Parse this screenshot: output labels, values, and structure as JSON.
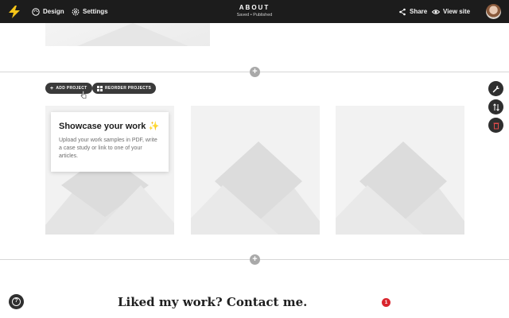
{
  "topbar": {
    "design_label": "Design",
    "settings_label": "Settings",
    "page_title": "ABOUT",
    "page_status": "Saved • Published",
    "share_label": "Share",
    "view_site_label": "View site"
  },
  "projects": {
    "add_label": "ADD PROJECT",
    "reorder_label": "REORDER PROJECTS",
    "tooltip_title": "Showcase your work",
    "tooltip_spark": "✨",
    "tooltip_body": "Upload your work samples in PDF, write a case study or link to one of your articles."
  },
  "section_add_symbol": "+",
  "contact_heading": "Liked my work? Contact me.",
  "notification_count": "1",
  "help_symbol": "?",
  "colors": {
    "topbar_bg": "#1c1c1c",
    "logo_yellow": "#f5c518",
    "badge_red": "#d9252d",
    "delete_red": "#e24b4b"
  }
}
